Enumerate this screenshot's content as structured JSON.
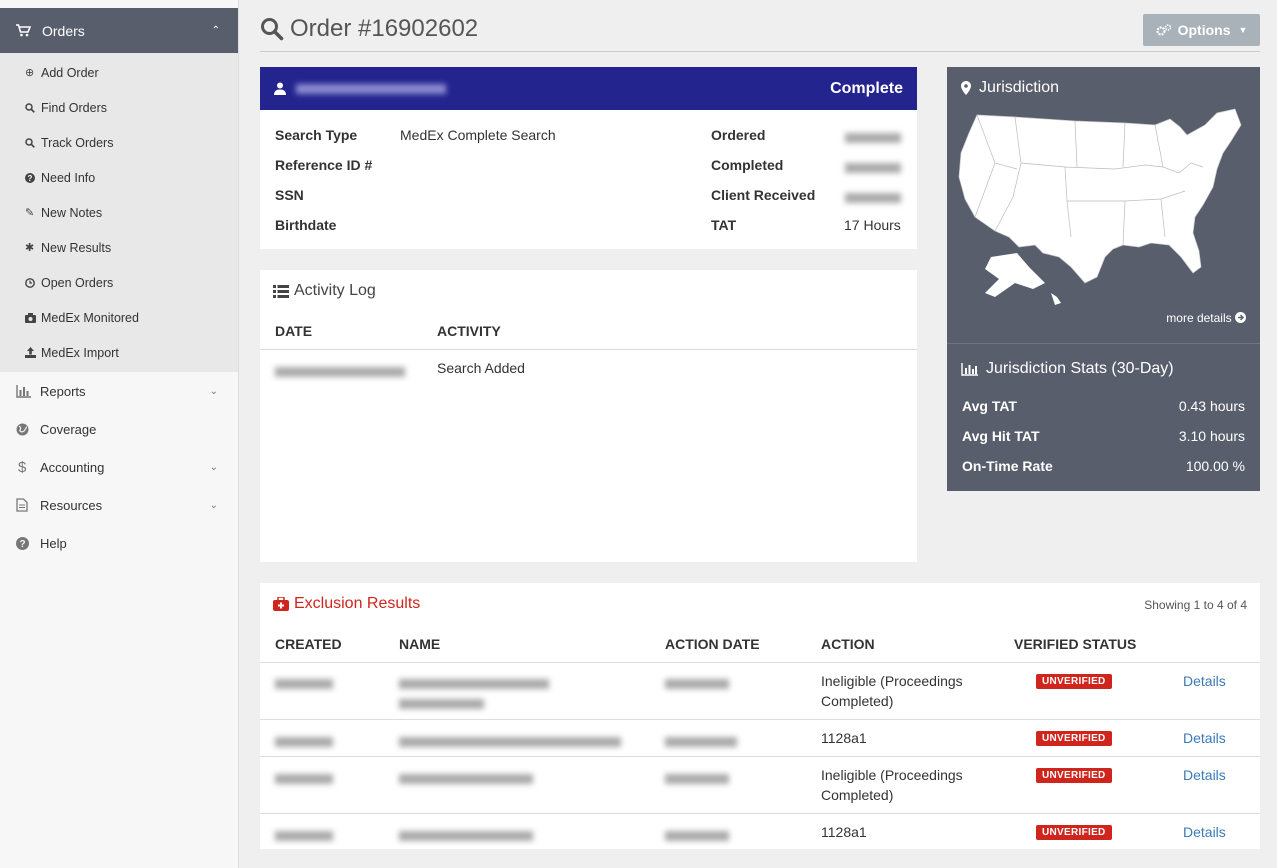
{
  "sidebar": {
    "orders_label": "Orders",
    "subitems": [
      {
        "label": "Add Order",
        "icon": "plus-circle-icon"
      },
      {
        "label": "Find Orders",
        "icon": "search-icon"
      },
      {
        "label": "Track Orders",
        "icon": "search-icon"
      },
      {
        "label": "Need Info",
        "icon": "question-circle-icon"
      },
      {
        "label": "New Notes",
        "icon": "edit-icon"
      },
      {
        "label": "New Results",
        "icon": "asterisk-icon"
      },
      {
        "label": "Open Orders",
        "icon": "clock-icon"
      },
      {
        "label": "MedEx Monitored",
        "icon": "camera-icon"
      },
      {
        "label": "MedEx Import",
        "icon": "upload-icon"
      }
    ],
    "items": [
      {
        "label": "Reports",
        "icon": "bar-chart-icon",
        "expandable": true
      },
      {
        "label": "Coverage",
        "icon": "globe-icon",
        "expandable": false
      },
      {
        "label": "Accounting",
        "icon": "dollar-icon",
        "expandable": true
      },
      {
        "label": "Resources",
        "icon": "file-icon",
        "expandable": true
      },
      {
        "label": "Help",
        "icon": "question-circle-icon",
        "expandable": false
      }
    ]
  },
  "header": {
    "title": "Order #16902602",
    "options_label": "Options"
  },
  "order": {
    "status": "Complete",
    "fields_left": [
      {
        "label": "Search Type",
        "value": "MedEx Complete Search"
      },
      {
        "label": "Reference ID #",
        "value": ""
      },
      {
        "label": "SSN",
        "value": ""
      },
      {
        "label": "Birthdate",
        "value": ""
      }
    ],
    "fields_right": [
      {
        "label": "Ordered"
      },
      {
        "label": "Completed"
      },
      {
        "label": "Client Received"
      },
      {
        "label": "TAT",
        "value": "17 Hours"
      }
    ]
  },
  "activity": {
    "title": "Activity Log",
    "col_date": "DATE",
    "col_activity": "ACTIVITY",
    "rows": [
      {
        "activity": "Search Added"
      }
    ]
  },
  "jurisdiction": {
    "title": "Jurisdiction",
    "more_details": "more details",
    "stats_title": "Jurisdiction Stats (30-Day)",
    "stats": [
      {
        "label": "Avg TAT",
        "value": "0.43 hours"
      },
      {
        "label": "Avg Hit TAT",
        "value": "3.10 hours"
      },
      {
        "label": "On-Time Rate",
        "value": "100.00 %"
      }
    ]
  },
  "exclusion": {
    "title": "Exclusion Results",
    "showing": "Showing 1 to 4 of 4",
    "columns": [
      "CREATED",
      "NAME",
      "ACTION DATE",
      "ACTION",
      "VERIFIED STATUS"
    ],
    "rows": [
      {
        "action_line1": "Ineligible (Proceedings",
        "action_line2": "Completed)",
        "status": "UNVERIFIED",
        "link": "Details"
      },
      {
        "action_line1": "1128a1",
        "action_line2": "",
        "status": "UNVERIFIED",
        "link": "Details"
      },
      {
        "action_line1": "Ineligible (Proceedings",
        "action_line2": "Completed)",
        "status": "UNVERIFIED",
        "link": "Details"
      },
      {
        "action_line1": "1128a1",
        "action_line2": "",
        "status": "UNVERIFIED",
        "link": "Details"
      }
    ]
  }
}
